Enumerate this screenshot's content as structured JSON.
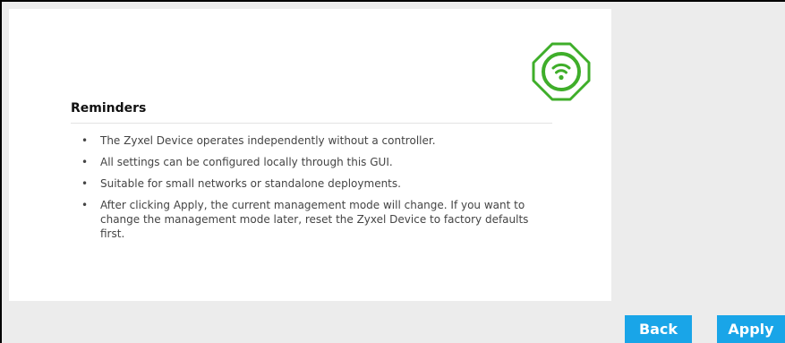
{
  "icon": "wifi-icon",
  "colors": {
    "accent_green": "#3fae2a",
    "button_blue": "#19a5e8",
    "panel_gray": "#ececec"
  },
  "reminders": {
    "title": "Reminders",
    "items": [
      "The Zyxel Device operates independently without a controller.",
      "All settings can be configured locally through this GUI.",
      "Suitable for small networks or standalone deployments.",
      "After clicking Apply, the current management mode will change. If you want to change the management mode later, reset the Zyxel Device to factory defaults first."
    ]
  },
  "buttons": {
    "back": "Back",
    "apply": "Apply"
  }
}
